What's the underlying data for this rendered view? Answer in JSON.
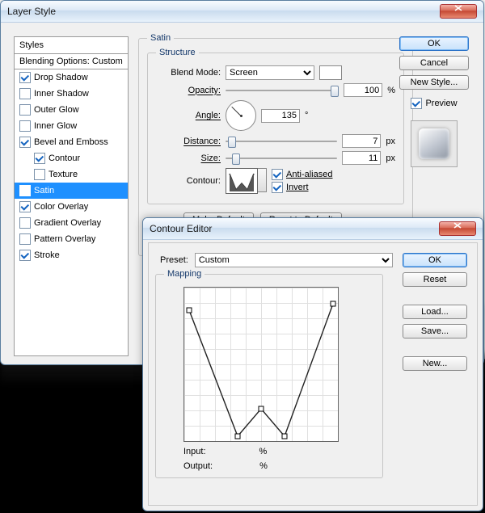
{
  "layerStyle": {
    "title": "Layer Style",
    "stylesHead": "Styles",
    "blendingOpts": "Blending Options: Custom",
    "items": [
      {
        "label": "Drop Shadow",
        "checked": true
      },
      {
        "label": "Inner Shadow",
        "checked": false
      },
      {
        "label": "Outer Glow",
        "checked": false
      },
      {
        "label": "Inner Glow",
        "checked": false
      },
      {
        "label": "Bevel and Emboss",
        "checked": true
      },
      {
        "label": "Contour",
        "checked": true,
        "indent": true
      },
      {
        "label": "Texture",
        "checked": false,
        "indent": true
      },
      {
        "label": "Satin",
        "checked": true,
        "sel": true
      },
      {
        "label": "Color Overlay",
        "checked": true
      },
      {
        "label": "Gradient Overlay",
        "checked": false
      },
      {
        "label": "Pattern Overlay",
        "checked": false
      },
      {
        "label": "Stroke",
        "checked": true
      }
    ],
    "satin": {
      "groupLabel": "Satin",
      "structureLabel": "Structure",
      "blendModeLabel": "Blend Mode:",
      "blendModeValue": "Screen",
      "opacityLabel": "Opacity:",
      "opacityValue": "100",
      "pct": "%",
      "angleLabel": "Angle:",
      "angleValue": "135",
      "deg": "°",
      "distanceLabel": "Distance:",
      "distanceValue": "7",
      "sizeLabel": "Size:",
      "sizeValue": "11",
      "px": "px",
      "contourLabel": "Contour:",
      "antiAliased": "Anti-aliased",
      "invert": "Invert",
      "makeDefault": "Make Default",
      "resetDefault": "Reset to Default"
    },
    "buttons": {
      "ok": "OK",
      "cancel": "Cancel",
      "newStyle": "New Style...",
      "preview": "Preview"
    }
  },
  "contourEditor": {
    "title": "Contour Editor",
    "presetLabel": "Preset:",
    "presetValue": "Custom",
    "mappingLabel": "Mapping",
    "inputLabel": "Input:",
    "outputLabel": "Output:",
    "pct": "%",
    "buttons": {
      "ok": "OK",
      "reset": "Reset",
      "load": "Load...",
      "save": "Save...",
      "new": "New..."
    }
  }
}
